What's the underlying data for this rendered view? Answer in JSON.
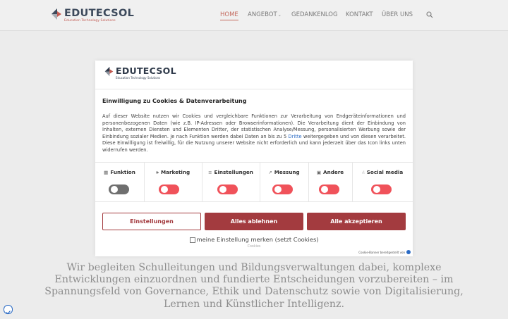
{
  "site": {
    "logo_name": "EDUTECSOL",
    "logo_tagline": "Education Technology Solutions"
  },
  "nav": {
    "items": [
      {
        "label": "HOME",
        "active": true
      },
      {
        "label": "ANGEBOT",
        "dropdown": true
      },
      {
        "label": "GEDANKENLOG"
      },
      {
        "label": "KONTAKT"
      },
      {
        "label": "ÜBER UNS"
      }
    ],
    "search_icon": "search-icon"
  },
  "background_text": "Wir begleiten Schulleitungen und Bildungsverwaltungen dabei, komplexe Entwicklungen einzuordnen und fundierte Entscheidungen vorzubereiten – im Spannungsfeld von Governance, Ethik und Datenschutz sowie von Digitalisierung, Lernen und Künstlicher Intelligenz.",
  "modal": {
    "logo_name": "EDUTECSOL",
    "logo_tagline": "Education Technology Solutions",
    "title": "Einwilligung zu Cookies & Datenverarbeitung",
    "body_before_link": "Auf dieser Website nutzen wir Cookies und vergleichbare Funktionen zur Verarbeitung von Endgeräteinformationen und personenbezogenen Daten (wie z.B. IP-Adressen oder Browserinformationen). Die Verarbeitung dient der Einbindung von Inhalten, externen Diensten und Elementen Dritter, der statistischen Analyse/Messung, personalisierten Werbung sowie der Einbindung sozialer Medien. Je nach Funktion werden dabei Daten an bis zu 5 ",
    "body_link": "Dritte",
    "body_after_link": " weitergegeben und von diesen verarbeitet. Diese Einwilligung ist freiwillig, für die Nutzung unserer Website nicht erforderlich und kann jederzeit über das Icon links unten widerrufen werden.",
    "categories": [
      {
        "label": "Funktion",
        "icon": "grid-icon",
        "state": "fixed",
        "color": "#6f6f6f"
      },
      {
        "label": "Marketing",
        "icon": "megaphone-icon",
        "state": "off",
        "color": "#f0525a"
      },
      {
        "label": "Einstellungen",
        "icon": "sliders-icon",
        "state": "off",
        "color": "#f0525a"
      },
      {
        "label": "Messung",
        "icon": "chart-icon",
        "state": "off",
        "color": "#f0525a"
      },
      {
        "label": "Andere",
        "icon": "chat-icon",
        "state": "off",
        "color": "#f0525a"
      },
      {
        "label": "Social media",
        "icon": "thumbs-up-icon",
        "state": "off",
        "color": "#f0525a"
      }
    ],
    "buttons": {
      "settings": "Einstellungen",
      "deny": "Alles ablehnen",
      "accept": "Alle akzeptieren"
    },
    "remember_label": "meine Einstellung merken (setzt Cookies)",
    "remember_checked": false,
    "cookies_small": "Cookies",
    "credit": "Cookie-Banner bereitgestellt von"
  },
  "colors": {
    "accent": "#a33b3f",
    "nav_active": "#c46a5e",
    "toggle_off": "#f0525a",
    "toggle_fixed": "#6f6f6f",
    "link": "#2a6ac4"
  }
}
